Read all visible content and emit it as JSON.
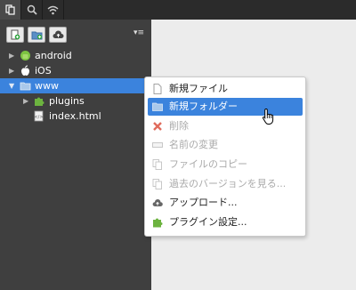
{
  "tabs": [
    {
      "icon": "files-icon"
    },
    {
      "icon": "search-icon"
    },
    {
      "icon": "wifi-icon"
    }
  ],
  "toolbar": {
    "buttons": [
      {
        "icon": "new-file-icon"
      },
      {
        "icon": "new-folder-icon"
      },
      {
        "icon": "cloud-upload-icon"
      }
    ],
    "menu_toggle": "▾≡"
  },
  "tree": {
    "items": [
      {
        "label": "android",
        "icon": "android-icon",
        "expanded": false,
        "selected": false
      },
      {
        "label": "iOS",
        "icon": "apple-icon",
        "expanded": false,
        "selected": false
      },
      {
        "label": "www",
        "icon": "folder-icon",
        "expanded": true,
        "selected": true
      },
      {
        "label": "plugins",
        "icon": "puzzle-icon",
        "expanded": false,
        "selected": false
      },
      {
        "label": "index.html",
        "icon": "html-file-icon",
        "selected": false
      }
    ]
  },
  "context_menu": {
    "items": [
      {
        "label": "新規ファイル",
        "icon": "file-icon",
        "state": "normal"
      },
      {
        "label": "新規フォルダー",
        "icon": "folder-icon",
        "state": "hover"
      },
      {
        "label": "削除",
        "icon": "delete-icon",
        "state": "disabled"
      },
      {
        "label": "名前の変更",
        "icon": "rename-icon",
        "state": "disabled"
      },
      {
        "label": "ファイルのコピー",
        "icon": "copy-icon",
        "state": "disabled"
      },
      {
        "label": "過去のバージョンを見る...",
        "icon": "history-icon",
        "state": "disabled"
      },
      {
        "label": "アップロード...",
        "icon": "cloud-upload-icon",
        "state": "normal"
      },
      {
        "label": "プラグイン設定...",
        "icon": "puzzle-icon",
        "state": "normal"
      }
    ]
  },
  "colors": {
    "panel_bg": "#3f3f3f",
    "selection": "#3b83dd",
    "disabled_text": "#aaaaaa"
  }
}
